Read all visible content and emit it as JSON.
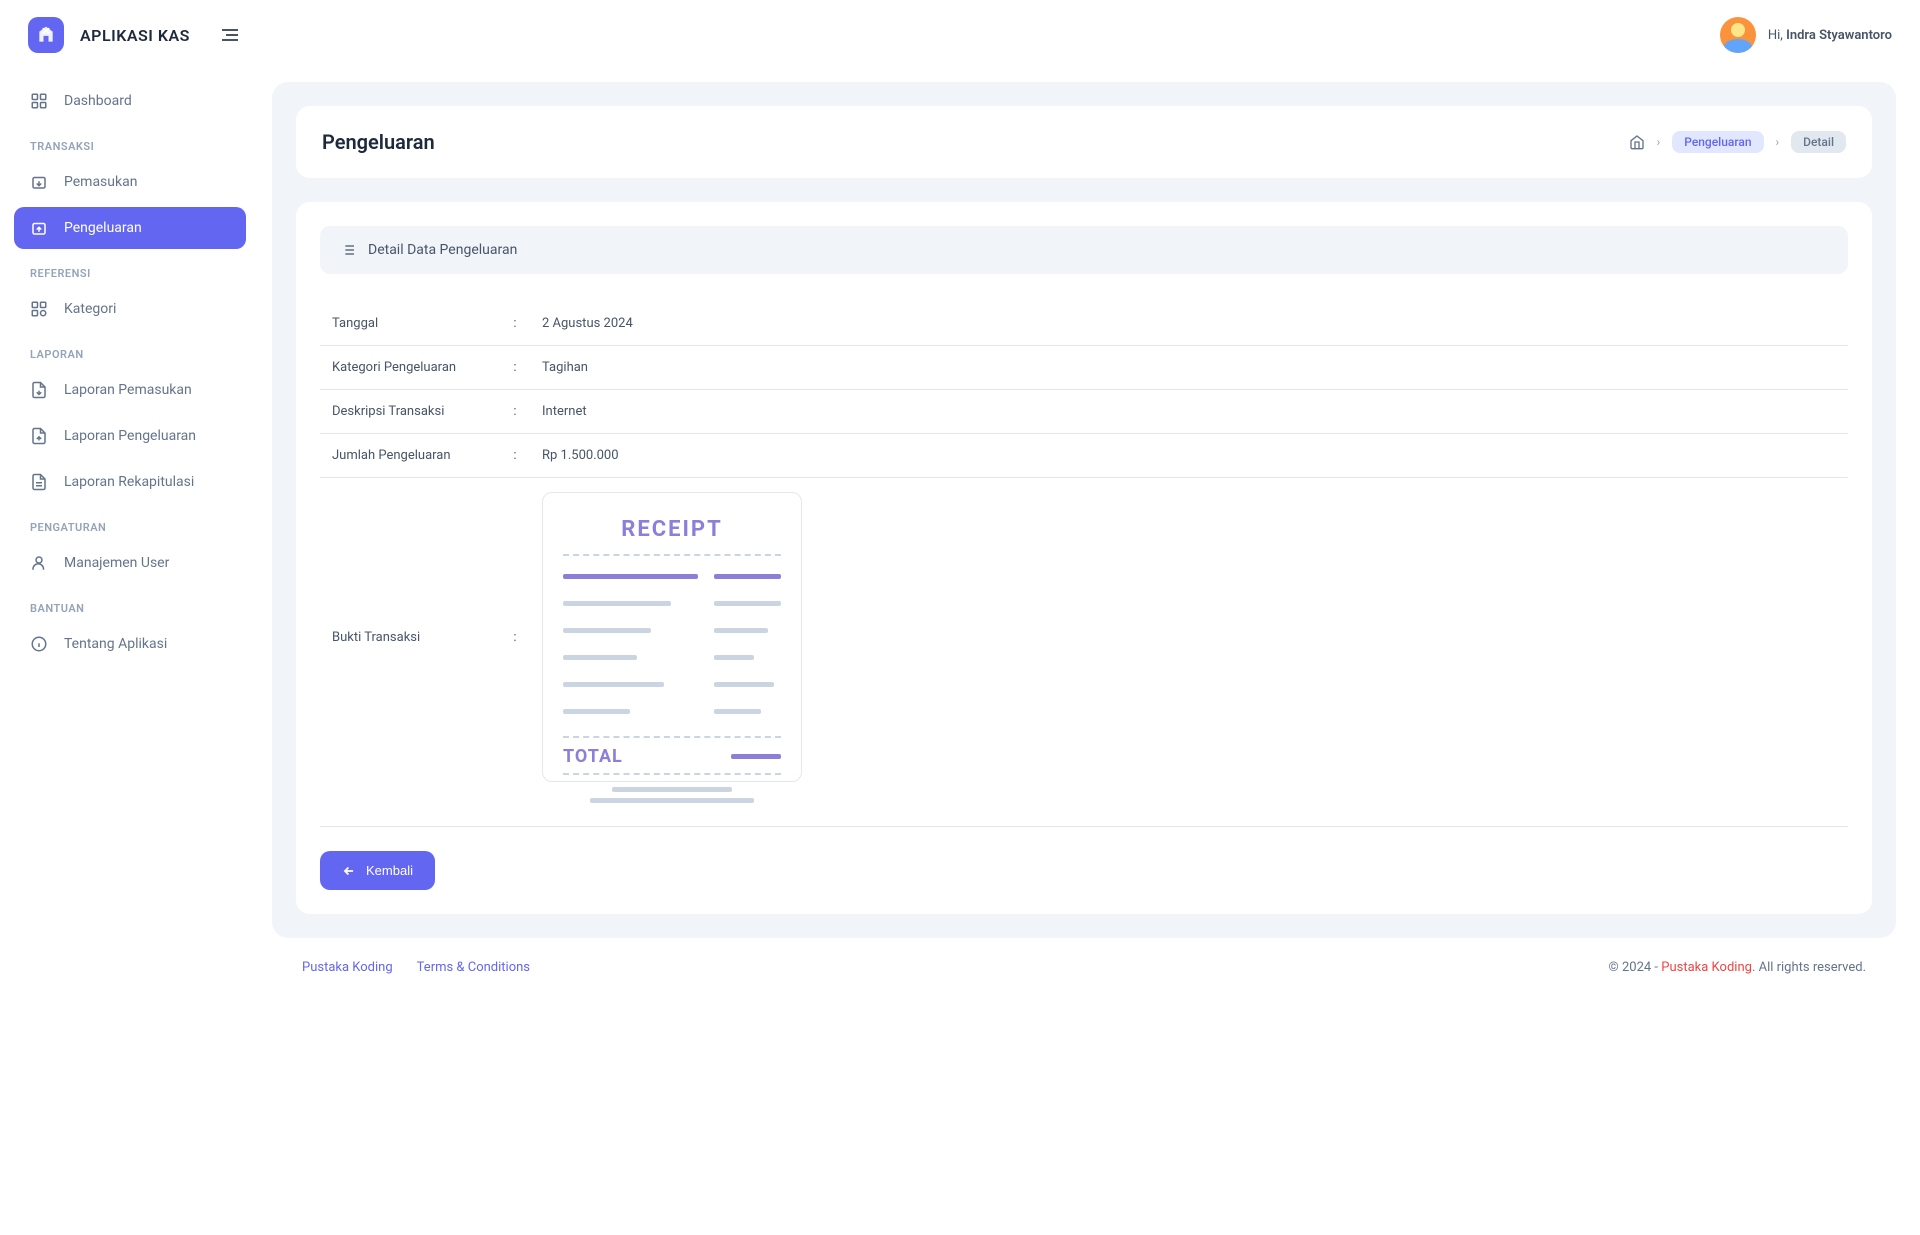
{
  "app_name": "APLIKASI KAS",
  "user": {
    "greeting_prefix": "Hi, ",
    "name": "Indra Styawantoro"
  },
  "sidebar": {
    "dashboard": "Dashboard",
    "section_transaksi": "TRANSAKSI",
    "pemasukan": "Pemasukan",
    "pengeluaran": "Pengeluaran",
    "section_referensi": "REFERENSI",
    "kategori": "Kategori",
    "section_laporan": "LAPORAN",
    "laporan_pemasukan": "Laporan Pemasukan",
    "laporan_pengeluaran": "Laporan Pengeluaran",
    "laporan_rekapitulasi": "Laporan Rekapitulasi",
    "section_pengaturan": "PENGATURAN",
    "manajemen_user": "Manajemen User",
    "section_bantuan": "BANTUAN",
    "tentang_aplikasi": "Tentang Aplikasi"
  },
  "page": {
    "title": "Pengeluaran",
    "breadcrumb_link": "Pengeluaran",
    "breadcrumb_current": "Detail"
  },
  "card": {
    "header": "Detail Data Pengeluaran",
    "rows": {
      "tanggal_label": "Tanggal",
      "tanggal_value": "2 Agustus 2024",
      "kategori_label": "Kategori Pengeluaran",
      "kategori_value": "Tagihan",
      "deskripsi_label": "Deskripsi Transaksi",
      "deskripsi_value": "Internet",
      "jumlah_label": "Jumlah Pengeluaran",
      "jumlah_value": "Rp 1.500.000",
      "bukti_label": "Bukti Transaksi"
    },
    "receipt": {
      "title": "RECEIPT",
      "total": "TOTAL"
    }
  },
  "buttons": {
    "kembali": "Kembali"
  },
  "footer": {
    "link1": "Pustaka Koding",
    "link2": "Terms & Conditions",
    "copyright_prefix": "© 2024 - ",
    "brand": "Pustaka Koding",
    "copyright_suffix": ". All rights reserved."
  }
}
